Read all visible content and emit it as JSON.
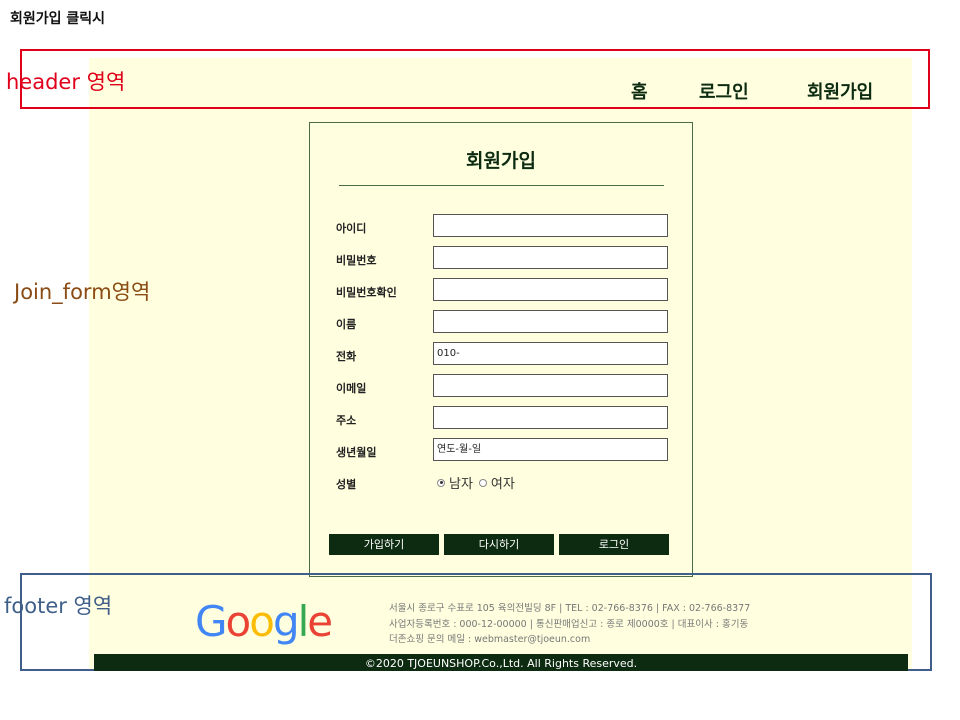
{
  "page": {
    "caption": "회원가입 클릭시"
  },
  "annotations": {
    "header_label": "header 영역",
    "form_label": "Join_form영역",
    "footer_label": "footer 영역"
  },
  "header": {
    "nav": [
      {
        "label": "홈"
      },
      {
        "label": "로그인"
      },
      {
        "label": "회원가입"
      }
    ]
  },
  "join_form": {
    "title": "회원가입",
    "fields": [
      {
        "label": "아이디",
        "value": ""
      },
      {
        "label": "비밀번호",
        "value": ""
      },
      {
        "label": "비밀번호확인",
        "value": ""
      },
      {
        "label": "이름",
        "value": ""
      },
      {
        "label": "전화",
        "value": "010-"
      },
      {
        "label": "이메일",
        "value": ""
      },
      {
        "label": "주소",
        "value": ""
      },
      {
        "label": "생년월일",
        "value": "연도-월-일"
      }
    ],
    "gender": {
      "label": "성별",
      "options": [
        {
          "label": "남자",
          "checked": true
        },
        {
          "label": "여자",
          "checked": false
        }
      ]
    },
    "buttons": {
      "join": "가입하기",
      "reset": "다시하기",
      "login": "로그인"
    }
  },
  "footer": {
    "logo": {
      "letters": [
        "G",
        "o",
        "o",
        "g",
        "l",
        "e"
      ],
      "colors": [
        "#4285f4",
        "#ea4335",
        "#fbbc05",
        "#4285f4",
        "#34a853",
        "#ea4335"
      ]
    },
    "info": [
      "서울시 종로구 수표로 105 육의전빌딩 8F | TEL : 02-766-8376 | FAX : 02-766-8377",
      "사업자등록번호 : 000-12-00000 | 통신판매업신고 : 종로 제0000호 | 대표이사 : 홍기동",
      "더존쇼핑 문의 메일 : webmaster@tjoeun.com"
    ],
    "copyright": "©2020 TJOEUNSHOP.Co.,Ltd. All Rights Reserved."
  },
  "colors": {
    "accent_dark_green": "#0c2b10",
    "background_cream": "#ffffe0",
    "header_outline": "#e0001a",
    "footer_outline": "#3f5f8a",
    "form_annotation": "#8a4b14"
  }
}
